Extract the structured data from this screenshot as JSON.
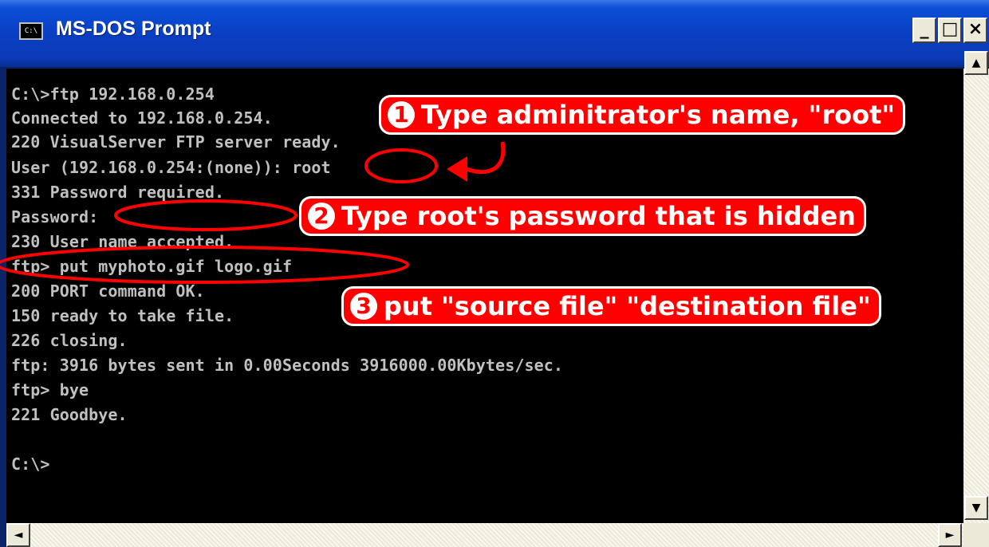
{
  "window": {
    "title": "MS-DOS Prompt",
    "icon_text": "C:\\",
    "controls": {
      "minimize": "_",
      "maximize": "□",
      "close": "×"
    }
  },
  "console": {
    "lines": [
      "C:\\>ftp 192.168.0.254",
      "Connected to 192.168.0.254.",
      "220 VisualServer FTP server ready.",
      "User (192.168.0.254:(none)): root",
      "331 Password required.",
      "Password:",
      "230 User name accepted.",
      "ftp> put myphoto.gif logo.gif",
      "200 PORT command OK.",
      "150 ready to take file.",
      "226 closing.",
      "ftp: 3916 bytes sent in 0.00Seconds 3916000.00Kbytes/sec.",
      "ftp> bye",
      "221 Goodbye.",
      "",
      "C:\\>"
    ]
  },
  "annotations": [
    {
      "num": "1",
      "text": "Type adminitrator's name, \"root\""
    },
    {
      "num": "2",
      "text": "Type root's password that is hidden"
    },
    {
      "num": "3",
      "text": "put \"source file\" \"destination file\""
    }
  ],
  "scrollbar": {
    "up": "▲",
    "down": "▼",
    "left": "◄",
    "right": "►"
  },
  "colors": {
    "annotation": "#ff0000",
    "console_bg": "#000000",
    "console_text": "#c0c0c0",
    "title_bar": "#0a3fc3"
  }
}
